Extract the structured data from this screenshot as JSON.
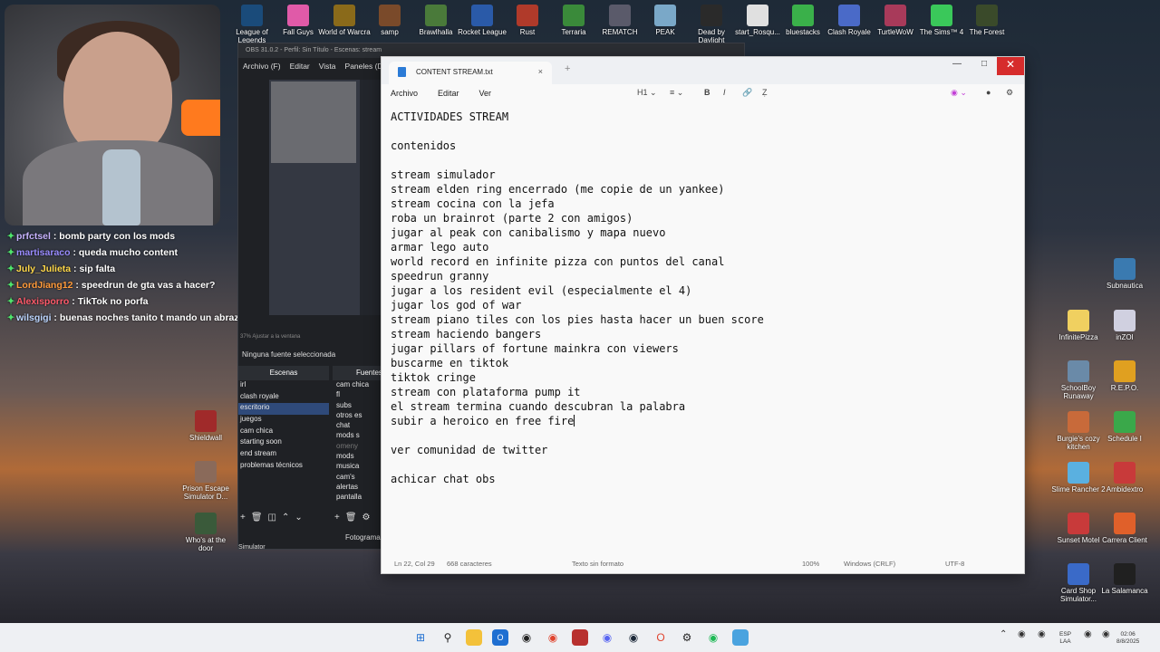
{
  "desktop_icons_top": [
    {
      "label": "League of Legends",
      "color": "#1a4b7a"
    },
    {
      "label": "Fall Guys",
      "color": "#e05aa8"
    },
    {
      "label": "World of Warcra",
      "color": "#8a6a1a"
    },
    {
      "label": "samp",
      "color": "#7a4a2a"
    },
    {
      "label": "Brawlhalla",
      "color": "#4a7a3a"
    },
    {
      "label": "Rocket League",
      "color": "#2a5aa8"
    },
    {
      "label": "Rust",
      "color": "#b03a2a"
    },
    {
      "label": "Terraria",
      "color": "#3a8a3a"
    },
    {
      "label": "REMATCH",
      "color": "#5a5a6a"
    },
    {
      "label": "PEAK",
      "color": "#7aa8c8"
    },
    {
      "label": "Dead by Daylight",
      "color": "#2a2a2a"
    },
    {
      "label": "start_Rosqu...",
      "color": "#e0e0e0"
    },
    {
      "label": "bluestacks",
      "color": "#3ab04a"
    },
    {
      "label": "Clash Royale",
      "color": "#4a6ac8"
    },
    {
      "label": "TurtleWoW",
      "color": "#a83a5a"
    },
    {
      "label": "The Sims™ 4",
      "color": "#3ac85a"
    },
    {
      "label": "The Forest",
      "color": "#3a4a2a"
    }
  ],
  "desktop_icons_right": [
    {
      "label": "Subnautica",
      "color": "#3a7ab0"
    },
    {
      "label": "InfinitePizza",
      "color": "#f0d060"
    },
    {
      "label": "inZOI",
      "color": "#d0d0e0"
    },
    {
      "label": "SchoolBoy Runaway",
      "color": "#6a8aa8"
    },
    {
      "label": "R.E.P.O.",
      "color": "#e0a020"
    },
    {
      "label": "Burgie's cozy kitchen",
      "color": "#c86a3a"
    },
    {
      "label": "Schedule I",
      "color": "#3aa84a"
    },
    {
      "label": "Slime Rancher 2",
      "color": "#5ab0e0"
    },
    {
      "label": "Ambidextro",
      "color": "#c83a3a"
    },
    {
      "label": "Sunset Motel",
      "color": "#c83a3a"
    },
    {
      "label": "Carrera Client",
      "color": "#e0602a"
    },
    {
      "label": "Card Shop Simulator...",
      "color": "#3a6ac8"
    },
    {
      "label": "La Salamanca",
      "color": "#202020"
    }
  ],
  "desktop_icons_left": [
    {
      "label": "Shieldwall",
      "color": "#a02a2a"
    },
    {
      "label": "Prison Escape Simulator D...",
      "color": "#8a6a5a"
    },
    {
      "label": "Who's at the door",
      "color": "#3a5a3a"
    }
  ],
  "chat": [
    {
      "user": "prfctsel",
      "message": "bomb party con los mods",
      "user_color": "#c7b3ff"
    },
    {
      "user": "martisaraco",
      "message": "queda mucho content",
      "user_color": "#9a8cff"
    },
    {
      "user": "July_Julieta",
      "message": "sip falta",
      "user_color": "#ffd84a"
    },
    {
      "user": "LordJiang12",
      "message": "speedrun de gta vas a hacer?",
      "user_color": "#ff9a3a"
    },
    {
      "user": "Alexisporro",
      "message": "TikTok no porfa",
      "user_color": "#ff5a6a"
    },
    {
      "user": "wilsgigi",
      "message": "buenas noches tanito t mando un abrazo",
      "user_color": "#bcd6ff"
    }
  ],
  "obs": {
    "title": "OBS 31.0.2 - Perfil: Sin Título - Escenas: stream",
    "menu": [
      "Archivo (F)",
      "Editar",
      "Vista",
      "Paneles (D)"
    ],
    "scaling": "37% Ajustar a la ventana",
    "no_source": "Ninguna fuente seleccionada",
    "scenes_header": "Escenas",
    "sources_header": "Fuentes",
    "scenes": [
      "irl",
      "clash royale",
      "escritorio",
      "juegos",
      "cam chica",
      "starting soon",
      "end stream",
      "problemas técnicos"
    ],
    "active_scene": "escritorio",
    "sources": [
      "cam chica",
      "fl",
      "subs",
      "otros es",
      "chat",
      "mods s",
      "omeny",
      "mods",
      "musica",
      "cam's",
      "alertas",
      "pantalla"
    ],
    "fotogramas": "Fotogramas",
    "simulator": "Simulator"
  },
  "notepad": {
    "tab_title": "CONTENT STREAM.txt",
    "menu": [
      "Archivo",
      "Editar",
      "Ver"
    ],
    "heading_label": "H1",
    "lines": [
      "ACTIVIDADES STREAM",
      "",
      "contenidos",
      "",
      "stream simulador",
      "stream elden ring encerrado (me copie de un yankee)",
      "stream cocina con la jefa",
      "roba un brainrot (parte 2 con amigos)",
      "jugar al peak con canibalismo y mapa nuevo",
      "armar lego auto",
      "world record en infinite pizza con puntos del canal",
      "speedrun granny",
      "jugar a los resident evil (especialmente el 4)",
      "jugar los god of war",
      "stream piano tiles con los pies hasta hacer un buen score",
      "stream haciendo bangers",
      "jugar pillars of fortune mainkra con viewers",
      "buscarme en tiktok",
      "tiktok cringe",
      "stream con plataforma pump it",
      "el stream termina cuando descubran la palabra",
      "subir a heroico en free fire",
      "",
      "ver comunidad de twitter",
      "",
      "achicar chat obs"
    ],
    "status": {
      "position": "Ln 22, Col 29",
      "chars": "668 caracteres",
      "format": "Texto sin formato",
      "zoom": "100%",
      "line_ending": "Windows (CRLF)",
      "encoding": "UTF-8"
    }
  },
  "taskbar": {
    "lang": "ESP",
    "layout": "LAA",
    "time": "02:06",
    "date": "8/8/2025"
  },
  "colors": {
    "close_button": "#d62c2c",
    "obs_active_scene": "#2f4a7a"
  }
}
